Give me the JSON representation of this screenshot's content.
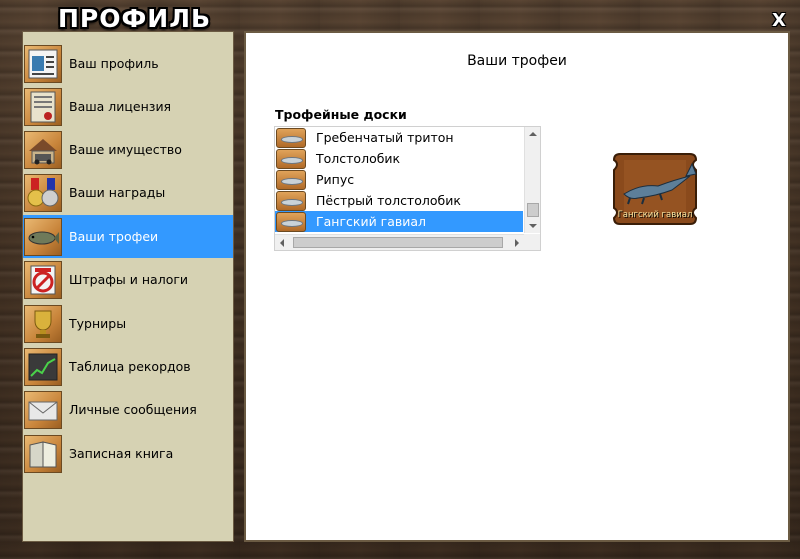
{
  "window": {
    "title": "ПРОФИЛЬ",
    "close_label": "X"
  },
  "sidebar": {
    "active_index": 4,
    "items": [
      {
        "label": "Ваш профиль",
        "icon": "profile-icon"
      },
      {
        "label": "Ваша лицензия",
        "icon": "license-icon"
      },
      {
        "label": "Ваше имущество",
        "icon": "property-icon"
      },
      {
        "label": "Ваши награды",
        "icon": "medals-icon"
      },
      {
        "label": "Ваши трофеи",
        "icon": "trophy-fish-icon"
      },
      {
        "label": "Штрафы и налоги",
        "icon": "fines-icon"
      },
      {
        "label": "Турниры",
        "icon": "cup-icon"
      },
      {
        "label": "Таблица рекордов",
        "icon": "chart-icon"
      },
      {
        "label": "Личные сообщения",
        "icon": "envelope-icon"
      },
      {
        "label": "Записная книга",
        "icon": "notebook-icon"
      }
    ]
  },
  "main": {
    "title": "Ваши трофеи",
    "boards_label": "Трофейные доски",
    "boards": [
      {
        "label": "Гребенчатый тритон"
      },
      {
        "label": "Толстолобик"
      },
      {
        "label": "Рипус"
      },
      {
        "label": "Пёстрый толстолобик"
      },
      {
        "label": "Гангский гавиал"
      }
    ],
    "selected_board": 4,
    "preview_label": "Гангский гавиал"
  },
  "colors": {
    "selection": "#3399ff",
    "sidebar_bg": "#d6d2b3",
    "plaque_wood": "#8a4a1c"
  }
}
